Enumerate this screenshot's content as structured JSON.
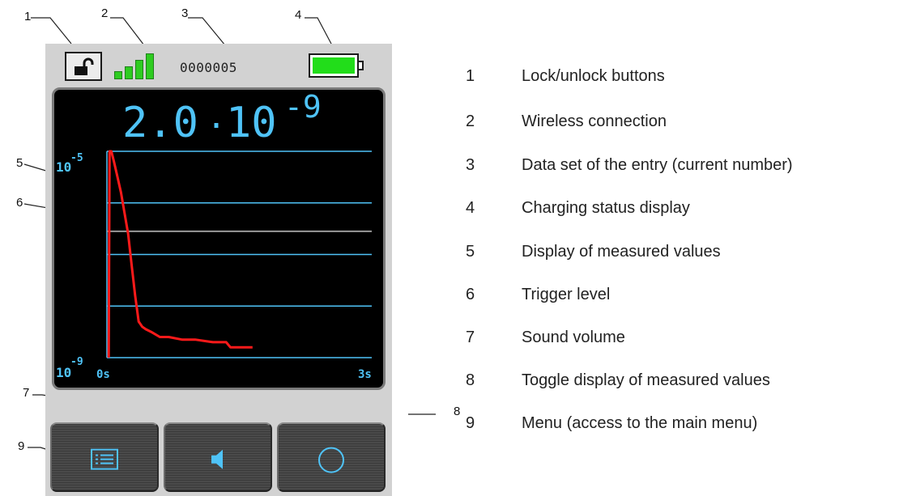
{
  "callouts": [
    "1",
    "2",
    "3",
    "4",
    "5",
    "6",
    "7",
    "8",
    "9"
  ],
  "device": {
    "dataset_number": "0000005",
    "signal_bars": 4,
    "battery_level": 1.0,
    "reading": {
      "mantissa": "2.0",
      "base": "10",
      "exponent": "-9"
    },
    "plot": {
      "y_top_base": "10",
      "y_top_exp": "-5",
      "y_bottom_base": "10",
      "y_bottom_exp": "-9",
      "x_start": "0s",
      "x_end": "3s",
      "trigger_fraction": 0.62
    },
    "buttons": {
      "menu_icon": "menu-list-icon",
      "sound_icon": "speaker-icon",
      "toggle_icon": "circle-icon"
    },
    "colors": {
      "axis_text": "#4fc3f7",
      "grid": "#4fc3f7",
      "trace": "#ff1a1a",
      "trigger": "#9a9a9a",
      "battery": "#22dd1a",
      "signal": "#2ecc20"
    }
  },
  "chart_data": {
    "type": "line",
    "xlabel": "",
    "ylabel": "",
    "xlim": [
      0,
      3
    ],
    "ylim": [
      -9,
      -5
    ],
    "y_scale": "log",
    "series": [
      {
        "x": [
          0.02,
          0.03,
          0.05,
          0.08,
          0.12,
          0.16,
          0.2,
          0.24,
          0.28,
          0.32,
          0.36,
          0.4,
          0.44,
          0.5,
          0.6,
          0.7,
          0.85,
          1.0,
          1.2,
          1.35,
          1.4,
          1.65
        ],
        "y": [
          -9.0,
          -5.0,
          -5.0,
          -5.2,
          -5.5,
          -5.8,
          -6.2,
          -6.6,
          -7.2,
          -7.8,
          -8.3,
          -8.4,
          -8.45,
          -8.5,
          -8.6,
          -8.6,
          -8.65,
          -8.65,
          -8.7,
          -8.7,
          -8.8,
          -8.8
        ]
      }
    ],
    "trigger_level": -6.55
  },
  "legend": [
    {
      "num": "1",
      "text": "Lock/unlock buttons"
    },
    {
      "num": "2",
      "text": "Wireless connection"
    },
    {
      "num": "3",
      "text": "Data set of the entry (current number)"
    },
    {
      "num": "4",
      "text": "Charging status display"
    },
    {
      "num": "5",
      "text": "Display of measured values"
    },
    {
      "num": "6",
      "text": "Trigger level"
    },
    {
      "num": "7",
      "text": "Sound volume"
    },
    {
      "num": "8",
      "text": "Toggle display of measured values"
    },
    {
      "num": "9",
      "text": "Menu (access to the main menu)"
    }
  ]
}
